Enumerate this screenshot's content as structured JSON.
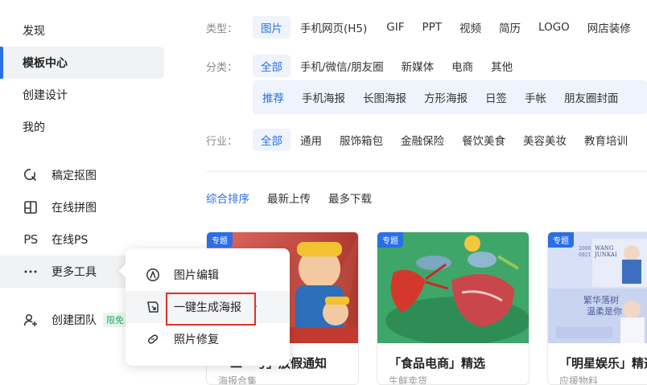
{
  "sidebar": {
    "nav": [
      {
        "label": "发现"
      },
      {
        "label": "模板中心"
      },
      {
        "label": "创建设计"
      },
      {
        "label": "我的"
      }
    ],
    "tools": [
      {
        "label": "稿定抠图",
        "icon": "cutout-icon"
      },
      {
        "label": "在线拼图",
        "icon": "collage-icon"
      },
      {
        "label": "在线PS",
        "icon": "ps-icon",
        "glyph": "PS"
      },
      {
        "label": "更多工具",
        "icon": "more-icon"
      }
    ],
    "team": {
      "label": "创建团队",
      "badge": "限免"
    }
  },
  "popup": {
    "items": [
      {
        "label": "图片编辑",
        "icon": "image-edit-icon"
      },
      {
        "label": "一键生成海报",
        "icon": "poster-generate-icon"
      },
      {
        "label": "照片修复",
        "icon": "photo-repair-icon"
      }
    ],
    "chevron": "›"
  },
  "filters": {
    "type": {
      "label": "类型：",
      "options": [
        "图片",
        "手机网页(H5)",
        "GIF",
        "PPT",
        "视频",
        "简历",
        "LOGO",
        "网店装修"
      ]
    },
    "category": {
      "label": "分类：",
      "options": [
        "全部",
        "手机/微信/朋友圈",
        "新媒体",
        "电商",
        "其他"
      ],
      "sub_options": [
        "推荐",
        "手机海报",
        "长图海报",
        "方形海报",
        "日签",
        "手帐",
        "朋友圈封面"
      ]
    },
    "industry": {
      "label": "行业：",
      "options": [
        "全部",
        "通用",
        "服饰箱包",
        "金融保险",
        "餐饮美食",
        "美容美妆",
        "教育培训"
      ]
    }
  },
  "sort": [
    "综合排序",
    "最新上传",
    "最多下载"
  ],
  "cards": [
    {
      "tag": "专题",
      "title": "「二一号」放假通知",
      "subtitle": "海报合集"
    },
    {
      "tag": "专题",
      "title": "「食品电商」精选",
      "subtitle": "生鲜卖货"
    },
    {
      "tag": "专题",
      "title": "「明星娱乐」精选",
      "subtitle": "应援物料",
      "poster_text": [
        "2000",
        "0921",
        "WANG",
        "JUNKAI",
        "繁华落树",
        "温柔是你"
      ]
    }
  ],
  "colors": {
    "accent": "#2a6ee8",
    "highlight_box": "#e03030",
    "free_badge": "#2aa860"
  }
}
